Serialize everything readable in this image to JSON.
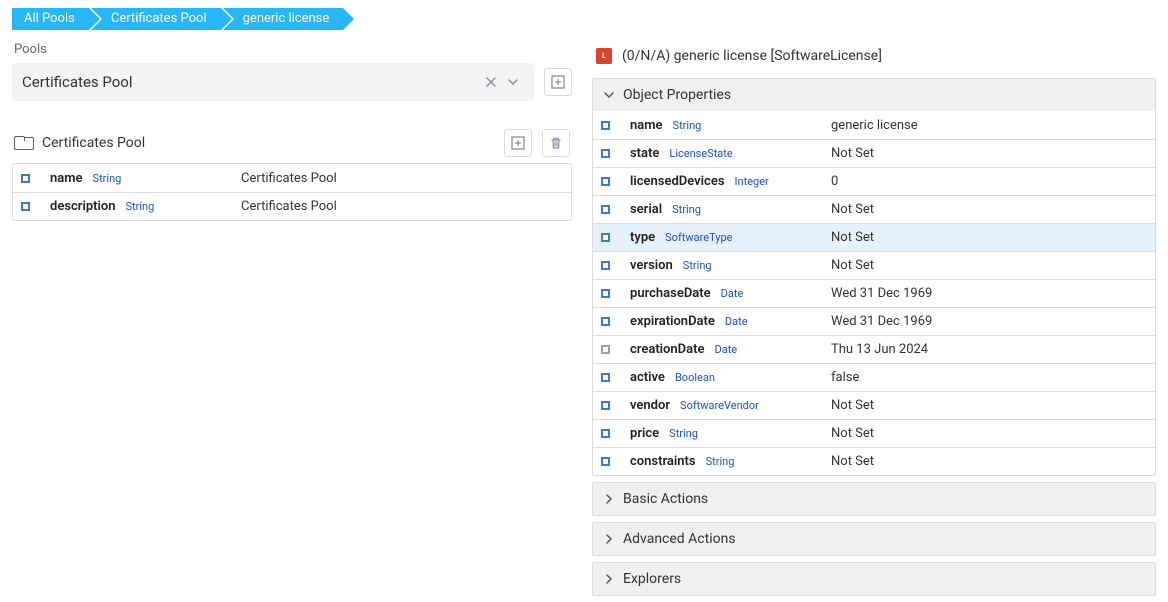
{
  "breadcrumbs": [
    {
      "label": "All Pools"
    },
    {
      "label": "Certificates Pool"
    },
    {
      "label": "generic license"
    }
  ],
  "pools": {
    "section_label": "Pools",
    "selected": "Certificates Pool"
  },
  "pool": {
    "title": "Certificates Pool",
    "rows": [
      {
        "name": "name",
        "type": "String",
        "value": "Certificates Pool"
      },
      {
        "name": "description",
        "type": "String",
        "value": "Certificates Pool"
      }
    ]
  },
  "object": {
    "header": "(0/N/A) generic license [SoftwareLicense]",
    "sections": {
      "properties_title": "Object Properties",
      "basic_actions_title": "Basic Actions",
      "advanced_actions_title": "Advanced Actions",
      "explorers_title": "Explorers"
    },
    "properties": [
      {
        "name": "name",
        "type": "String",
        "value": "generic license",
        "icon": "blue"
      },
      {
        "name": "state",
        "type": "LicenseState",
        "value": "Not Set",
        "icon": "blue"
      },
      {
        "name": "licensedDevices",
        "type": "Integer",
        "value": "0",
        "icon": "blue"
      },
      {
        "name": "serial",
        "type": "String",
        "value": "Not Set",
        "icon": "blue"
      },
      {
        "name": "type",
        "type": "SoftwareType",
        "value": "Not Set",
        "icon": "blue",
        "highlight": true
      },
      {
        "name": "version",
        "type": "String",
        "value": "Not Set",
        "icon": "blue"
      },
      {
        "name": "purchaseDate",
        "type": "Date",
        "value": "Wed 31 Dec 1969",
        "icon": "blue"
      },
      {
        "name": "expirationDate",
        "type": "Date",
        "value": "Wed 31 Dec 1969",
        "icon": "blue"
      },
      {
        "name": "creationDate",
        "type": "Date",
        "value": "Thu 13 Jun 2024",
        "icon": "grey"
      },
      {
        "name": "active",
        "type": "Boolean",
        "value": "false",
        "icon": "blue"
      },
      {
        "name": "vendor",
        "type": "SoftwareVendor",
        "value": "Not Set",
        "icon": "blue"
      },
      {
        "name": "price",
        "type": "String",
        "value": "Not Set",
        "icon": "blue"
      },
      {
        "name": "constraints",
        "type": "String",
        "value": "Not Set",
        "icon": "blue"
      }
    ]
  }
}
